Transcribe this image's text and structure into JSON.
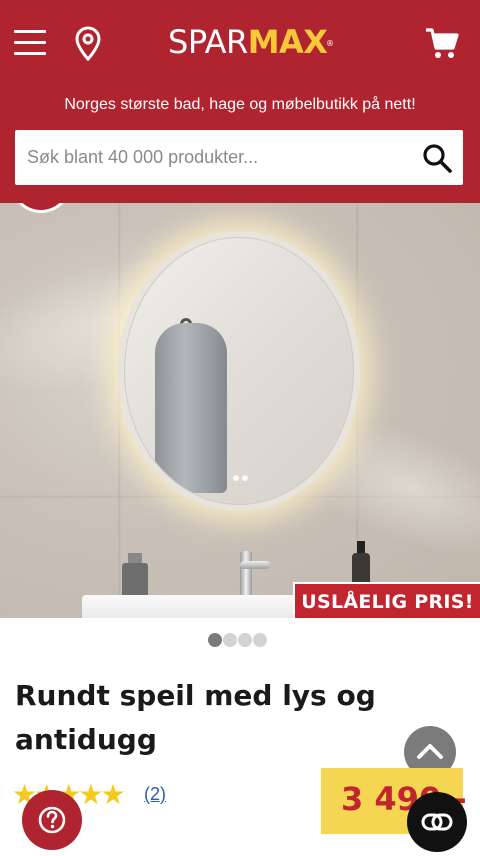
{
  "header": {
    "logo_part1": "SPAR",
    "logo_part2": "MAX",
    "logo_tm": "®",
    "tagline": "Norges største bad, hage og møbelbutikk på nett!",
    "menu_icon": "hamburger-menu-icon",
    "location_icon": "location-pin-icon",
    "cart_icon": "shopping-cart-icon"
  },
  "search": {
    "placeholder": "Søk blant 40 000 produkter...",
    "value": "",
    "icon": "search-icon"
  },
  "product": {
    "promo_badge": "USLÅELIG PRIS!",
    "title": "Rundt speil med lys og antidugg",
    "rating": 5,
    "stars": [
      "★",
      "★",
      "★",
      "★",
      "★"
    ],
    "review_count": "(2)",
    "price": "3 490,-"
  },
  "gallery": {
    "slide_count": 4,
    "active_index": 0
  },
  "floating": {
    "help_icon": "question-icon",
    "chat_icon": "chat-link-icon",
    "scroll_top_icon": "chevron-up-icon"
  },
  "colors": {
    "brand_red": "#b0242f",
    "logo_yellow": "#f6c83a",
    "price_bg": "#f6d552",
    "star": "#f2cb1d",
    "link_blue": "#2a5db0"
  }
}
